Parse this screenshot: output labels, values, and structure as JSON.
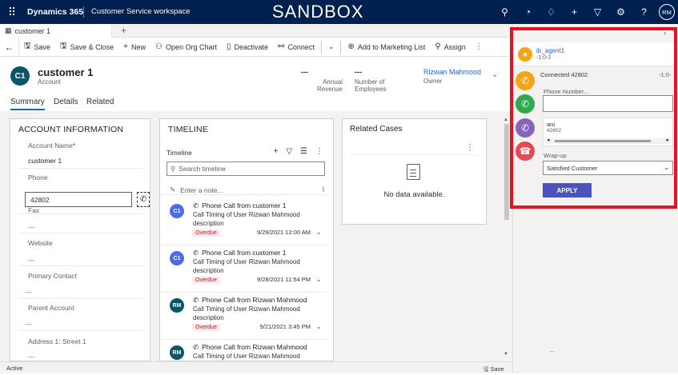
{
  "topbar": {
    "brand": "Dynamics 365",
    "app_name": "Customer Service workspace",
    "environment": "SANDBOX",
    "user_initials": "RM"
  },
  "session": {
    "tab_label": "customer 1",
    "add_label": "+"
  },
  "commands": [
    {
      "label": "Save",
      "icon": "save-icon"
    },
    {
      "label": "Save & Close",
      "icon": "save-close-icon"
    },
    {
      "label": "New",
      "icon": "plus-icon"
    },
    {
      "label": "Open Org Chart",
      "icon": "org-chart-icon"
    },
    {
      "label": "Deactivate",
      "icon": "deactivate-icon"
    },
    {
      "label": "Connect",
      "icon": "connect-icon"
    },
    {
      "label": "Add to Marketing List",
      "icon": "marketing-list-icon"
    },
    {
      "label": "Assign",
      "icon": "assign-icon"
    }
  ],
  "record": {
    "initials": "C1",
    "name": "customer 1",
    "entity": "Account",
    "annual_revenue_value": "---",
    "annual_revenue_label": "Annual Revenue",
    "employees_value": "---",
    "employees_label": "Number of Employees",
    "owner_value": "Rizwan Mahmood",
    "owner_label": "Owner"
  },
  "tabs": [
    "Summary",
    "Details",
    "Related"
  ],
  "account_info": {
    "title": "ACCOUNT INFORMATION",
    "account_name_label": "Account Name",
    "required_mark": "*",
    "account_name_value": "customer 1",
    "phone_label": "Phone",
    "phone_value": "42802",
    "fax_label": "Fax",
    "fax_value": "---",
    "website_label": "Website",
    "website_value": "---",
    "primary_contact_label": "Primary Contact",
    "primary_contact_value": "---",
    "parent_account_label": "Parent Account",
    "parent_account_value": "---",
    "address_label": "Address 1: Street 1",
    "address_value": "---"
  },
  "timeline": {
    "title": "TIMELINE",
    "bar_label": "Timeline",
    "search_placeholder": "Search timeline",
    "note_placeholder": "Enter a note...",
    "items": [
      {
        "initials": "C1",
        "title": "Phone Call from customer 1",
        "line2": "Call Timing of User Rizwan Mahmood",
        "line3": "description",
        "badge": "Overdue",
        "date": "9/29/2021 12:00 AM",
        "color": "#4f6bed"
      },
      {
        "initials": "C1",
        "title": "Phone Call from customer 1",
        "line2": "Call Timing of User Rizwan Mahmood",
        "line3": "description",
        "badge": "Overdue",
        "date": "9/28/2021 11:54 PM",
        "color": "#4f6bed"
      },
      {
        "initials": "RM",
        "title": "Phone Call from Rizwan Mahmood",
        "line2": "Call Timing of User Rizwan Mahmood",
        "line3": "description",
        "badge": "Overdue",
        "date": "9/21/2021 3:45 PM",
        "color": "#0b556a"
      },
      {
        "initials": "RM",
        "title": "Phone Call from Rizwan Mahmood",
        "line2": "Call Timing of User Rizwan Mahmood",
        "line3": "",
        "badge": "",
        "date": "",
        "color": "#0b556a"
      }
    ]
  },
  "related_cases": {
    "title": "Related Cases",
    "empty": "No data available."
  },
  "status": {
    "state": "Active",
    "save": "Save"
  },
  "cti": {
    "agent_name": "ib_agent1",
    "agent_sub": "-1:0-2",
    "connected": "Connected 42802",
    "timer": "-1:0-",
    "phone_label": "Phone Number...",
    "ani_name": "ani",
    "ani_number": "42802",
    "wrapup_label": "Wrap-up",
    "wrapup_value": "Satisfied Customer",
    "apply": "APPLY",
    "dash": "—",
    "buttons": [
      {
        "name": "answer-call-button",
        "color": "#f7a416"
      },
      {
        "name": "transfer-call-button",
        "color": "#2fa84f"
      },
      {
        "name": "conference-call-button",
        "color": "#8764b8"
      },
      {
        "name": "hangup-call-button",
        "color": "#e74856"
      }
    ]
  }
}
